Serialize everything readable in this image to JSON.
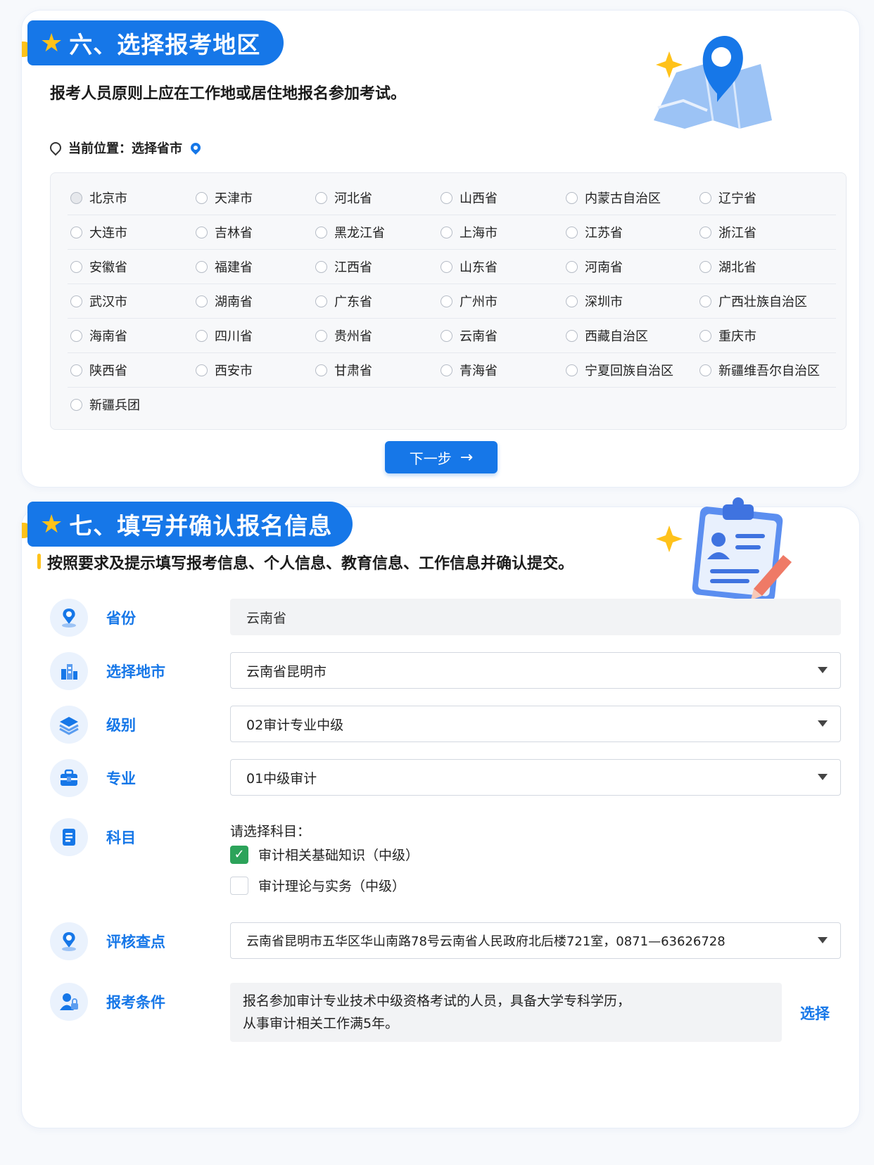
{
  "section6": {
    "title": "六、选择报考地区",
    "intro": "报考人员原则上应在工作地或居住地报名参加考试。",
    "location_label": "当前位置：选择省市",
    "regions": [
      [
        "北京市",
        "天津市",
        "河北省",
        "山西省",
        "内蒙古自治区",
        "辽宁省"
      ],
      [
        "大连市",
        "吉林省",
        "黑龙江省",
        "上海市",
        "江苏省",
        "浙江省"
      ],
      [
        "安徽省",
        "福建省",
        "江西省",
        "山东省",
        "河南省",
        "湖北省"
      ],
      [
        "武汉市",
        "湖南省",
        "广东省",
        "广州市",
        "深圳市",
        "广西壮族自治区"
      ],
      [
        "海南省",
        "四川省",
        "贵州省",
        "云南省",
        "西藏自治区",
        "重庆市"
      ],
      [
        "陕西省",
        "西安市",
        "甘肃省",
        "青海省",
        "宁夏回族自治区",
        "新疆维吾尔自治区"
      ],
      [
        "新疆兵团"
      ]
    ],
    "next_label": "下一步",
    "next_arrow": "→"
  },
  "section7": {
    "title": "七、填写并确认报名信息",
    "intro": "按照要求及提示填写报考信息、个人信息、教育信息、工作信息并确认提交。",
    "province": {
      "label": "省份",
      "value": "云南省"
    },
    "city": {
      "label": "选择地市",
      "value": "云南省昆明市"
    },
    "level": {
      "label": "级别",
      "value": "02审计专业中级"
    },
    "major": {
      "label": "专业",
      "value": "01中级审计"
    },
    "subject": {
      "label": "科目",
      "prompt": "请选择科目：",
      "options": [
        {
          "text": "审计相关基础知识（中级）",
          "checked": true
        },
        {
          "text": "审计理论与实务（中级）",
          "checked": false
        }
      ]
    },
    "review": {
      "label": "评核查点",
      "value": "云南省昆明市五华区华山南路78号云南省人民政府北后楼721室，0871—63626728"
    },
    "condition": {
      "label": "报考条件",
      "line1": "报名参加审计专业技术中级资格考试的人员，具备大学专科学历，",
      "line2": "从事审计相关工作满5年。",
      "select_label": "选择"
    }
  },
  "icons": {
    "star": "star-icon",
    "check": "✓"
  },
  "colors": {
    "accent": "#1677e8",
    "star": "#ffc21a",
    "check": "#2ca35a"
  }
}
